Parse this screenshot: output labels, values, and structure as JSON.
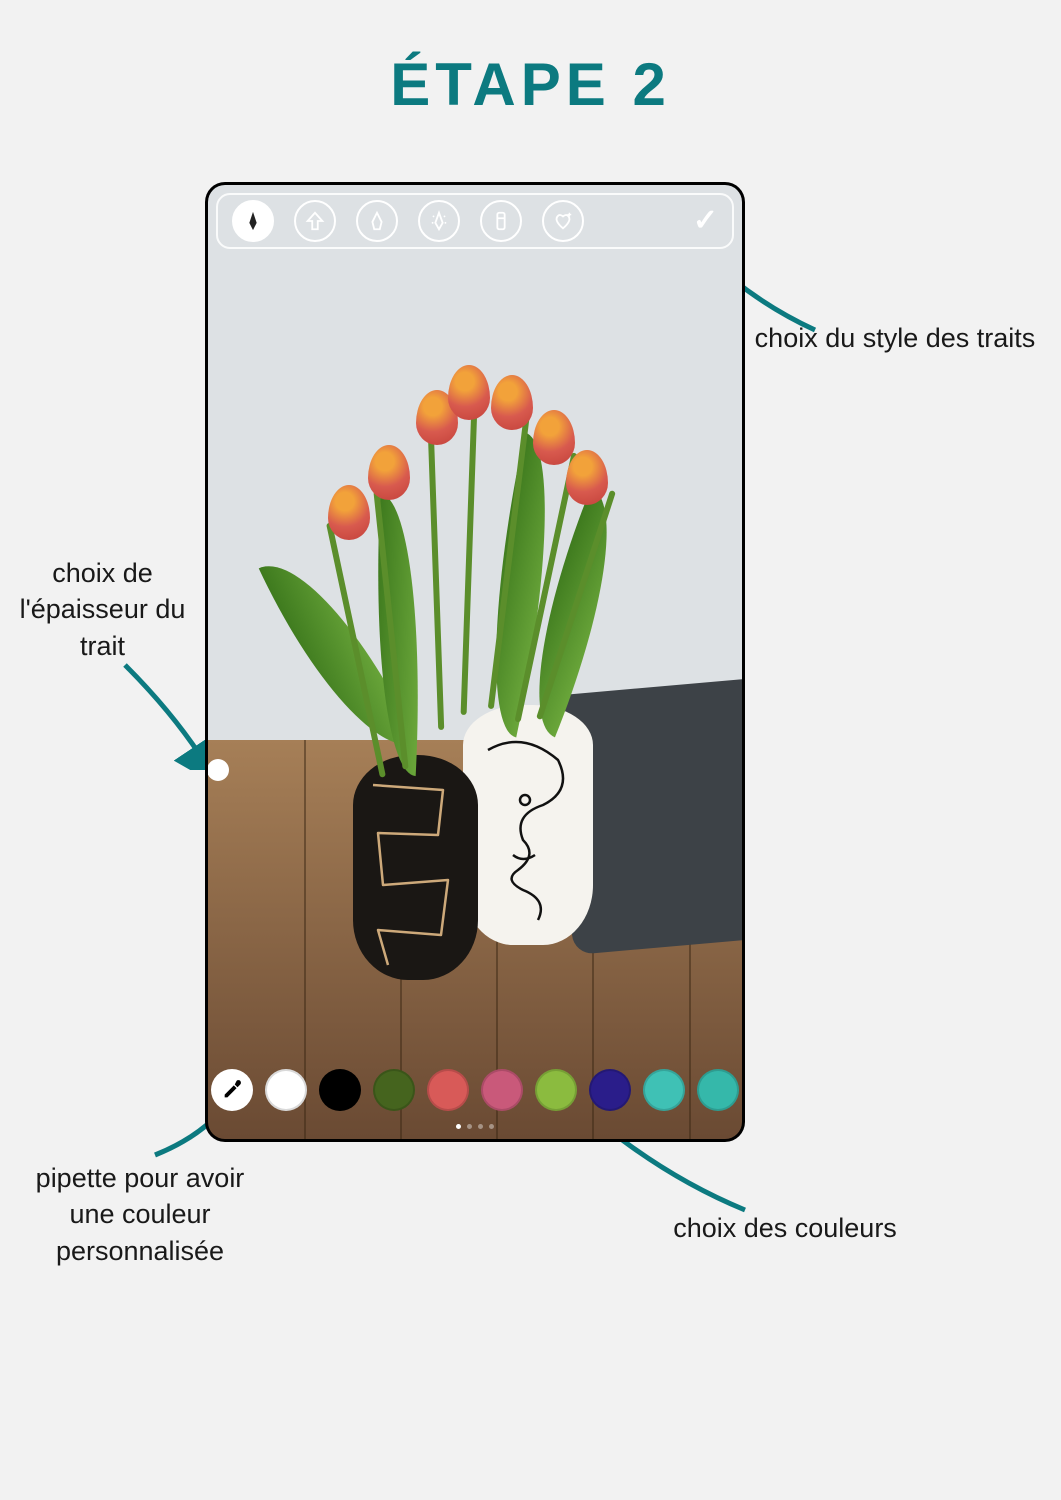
{
  "title": "ÉTAPE 2",
  "annotations": {
    "style": "choix du style des traits",
    "thickness": "choix de l'épaisseur du trait",
    "eyedropper": "pipette pour avoir une couleur personnalisée",
    "colors": "choix des couleurs"
  },
  "toolbar": {
    "tools": [
      {
        "name": "pen-tool",
        "icon": "pen",
        "selected": true
      },
      {
        "name": "arrow-tool",
        "icon": "arrow-up",
        "selected": false
      },
      {
        "name": "marker-tool",
        "icon": "marker",
        "selected": false
      },
      {
        "name": "neon-tool",
        "icon": "neon",
        "selected": false
      },
      {
        "name": "eraser-tool",
        "icon": "eraser",
        "selected": false
      },
      {
        "name": "heart-sparkle-tool",
        "icon": "heart",
        "selected": false
      }
    ],
    "done_label": "✓"
  },
  "thickness": {
    "value_position": 0.6
  },
  "palette": {
    "colors": [
      "#ffffff",
      "#000000",
      "#45641e",
      "#d85a58",
      "#c9597a",
      "#8bbb3f",
      "#2a1d8a",
      "#3fc1b5",
      "#35b8aa"
    ]
  },
  "pager": {
    "pages": 4,
    "active_index": 0
  },
  "photo": {
    "subject": "tulips-in-vases-on-wooden-table",
    "vases": [
      "black-squiggle-vase",
      "white-line-art-face-vase"
    ],
    "flower_count": 7
  }
}
